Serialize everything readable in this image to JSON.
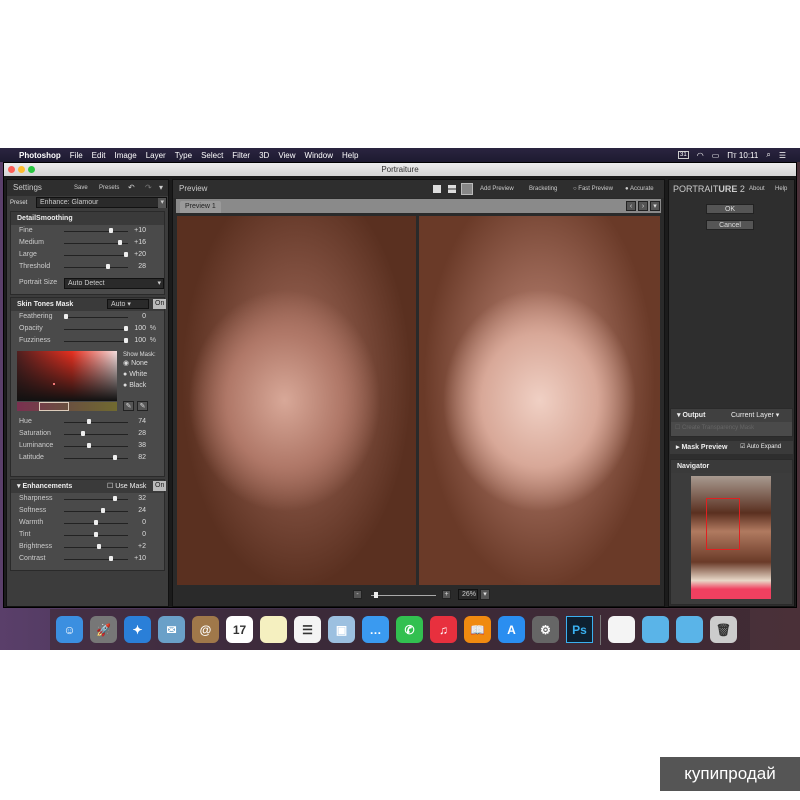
{
  "menubar": {
    "app": "Photoshop",
    "items": [
      "File",
      "Edit",
      "Image",
      "Layer",
      "Type",
      "Select",
      "Filter",
      "3D",
      "View",
      "Window",
      "Help"
    ],
    "calendar": "31",
    "clock": "Пт 10:11"
  },
  "window": {
    "title": "Portraiture"
  },
  "settings": {
    "title": "Settings",
    "save": "Save",
    "presets": "Presets",
    "preset_label": "Preset",
    "preset_value": "Enhance: Glamour",
    "detail": {
      "title": "DetailSmoothing",
      "sliders": [
        {
          "label": "Fine",
          "value": "+10",
          "pos": 0.75
        },
        {
          "label": "Medium",
          "value": "+16",
          "pos": 0.9
        },
        {
          "label": "Large",
          "value": "+20",
          "pos": 1.0
        },
        {
          "label": "Threshold",
          "value": "28",
          "pos": 0.7
        }
      ],
      "portrait_size_label": "Portrait Size",
      "portrait_size_value": "Auto Detect"
    },
    "skin": {
      "title": "Skin Tones Mask",
      "mode": "Auto",
      "on": "On",
      "sliders": [
        {
          "label": "Feathering",
          "value": "0",
          "unit": "",
          "pos": 0.0
        },
        {
          "label": "Opacity",
          "value": "100",
          "unit": "%",
          "pos": 1.0
        },
        {
          "label": "Fuzziness",
          "value": "100",
          "unit": "%",
          "pos": 1.0
        }
      ],
      "show_mask": "Show Mask:",
      "mask_options": [
        "None",
        "White",
        "Black"
      ],
      "mask_selected": 0,
      "hsl": [
        {
          "label": "Hue",
          "value": "74",
          "pos": 0.38
        },
        {
          "label": "Saturation",
          "value": "28",
          "pos": 0.28
        },
        {
          "label": "Luminance",
          "value": "38",
          "pos": 0.38
        },
        {
          "label": "Latitude",
          "value": "82",
          "pos": 0.82
        }
      ]
    },
    "enh": {
      "title": "Enhancements",
      "use_mask": "Use Mask",
      "on": "On",
      "sliders": [
        {
          "label": "Sharpness",
          "value": "32",
          "pos": 0.82
        },
        {
          "label": "Softness",
          "value": "24",
          "pos": 0.62
        },
        {
          "label": "Warmth",
          "value": "0",
          "pos": 0.5
        },
        {
          "label": "Tint",
          "value": "0",
          "pos": 0.5
        },
        {
          "label": "Brightness",
          "value": "+2",
          "pos": 0.55
        },
        {
          "label": "Contrast",
          "value": "+10",
          "pos": 0.75
        }
      ]
    }
  },
  "preview": {
    "title": "Preview",
    "add_preview": "Add Preview",
    "bracketing": "Bracketing",
    "fast_preview": "Fast Preview",
    "accurate": "Accurate",
    "tab": "Preview 1",
    "zoom": "26%",
    "zoom_pos": 0.05
  },
  "right": {
    "logo_a": "PORTRAIT",
    "logo_b": "URE",
    "logo_c": " 2",
    "about": "About",
    "help": "Help",
    "ok": "OK",
    "cancel": "Cancel",
    "output": "Output",
    "output_value": "Current Layer",
    "transparency": "Create Transparency Mask",
    "mask_preview": "Mask Preview",
    "auto_expand": "Auto Expand",
    "navigator": "Navigator"
  },
  "dock": [
    {
      "name": "finder",
      "color": "#3b8fe0",
      "glyph": "☺"
    },
    {
      "name": "launchpad",
      "color": "#777",
      "glyph": "🚀"
    },
    {
      "name": "safari",
      "color": "#2a7fd8",
      "glyph": "✦"
    },
    {
      "name": "mail",
      "color": "#6aa0c8",
      "glyph": "✉"
    },
    {
      "name": "contacts",
      "color": "#a0784a",
      "glyph": "@"
    },
    {
      "name": "calendar",
      "color": "#fff",
      "glyph": "17"
    },
    {
      "name": "notes",
      "color": "#f5f0c0",
      "glyph": ""
    },
    {
      "name": "reminders",
      "color": "#f4f4f4",
      "glyph": "☰"
    },
    {
      "name": "preview",
      "color": "#9cc0e0",
      "glyph": "▣"
    },
    {
      "name": "messages",
      "color": "#3a9af0",
      "glyph": "…"
    },
    {
      "name": "facetime",
      "color": "#32c050",
      "glyph": "✆"
    },
    {
      "name": "itunes",
      "color": "#e8303e",
      "glyph": "♫"
    },
    {
      "name": "ibooks",
      "color": "#f08a10",
      "glyph": "📖"
    },
    {
      "name": "app-store",
      "color": "#2a8ef0",
      "glyph": "A"
    },
    {
      "name": "system-preferences",
      "color": "#666",
      "glyph": "⚙"
    },
    {
      "name": "photoshop",
      "color": "#0e2030",
      "glyph": "Ps"
    },
    {
      "name": "documents",
      "color": "#f4f4f4",
      "glyph": ""
    },
    {
      "name": "folder",
      "color": "#5ab4e8",
      "glyph": ""
    },
    {
      "name": "folder-2",
      "color": "#5ab4e8",
      "glyph": ""
    },
    {
      "name": "trash",
      "color": "#ccc",
      "glyph": "🗑"
    }
  ],
  "watermark": "купипродай"
}
